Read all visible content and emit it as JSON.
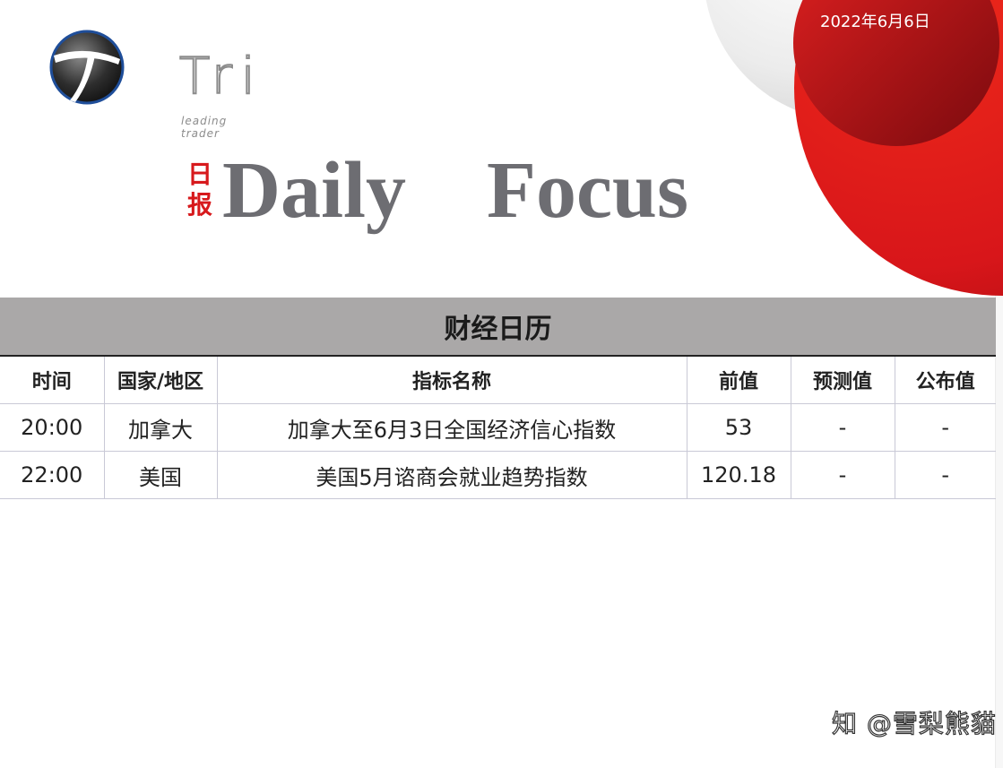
{
  "header": {
    "date": "2022年6月6日",
    "logo_word": "Tri",
    "logo_subtitle": "leading trader",
    "title_cn_top": "日",
    "title_cn_bottom": "报",
    "title": "Daily    Focus"
  },
  "calendar": {
    "title": "财经日历",
    "columns": [
      "时间",
      "国家/地区",
      "指标名称",
      "前值",
      "预测值",
      "公布值"
    ],
    "rows": [
      [
        "20:00",
        "加拿大",
        "加拿大至6月3日全国经济信心指数",
        "53",
        "-",
        "-"
      ],
      [
        "22:00",
        "美国",
        "美国5月谘商会就业趋势指数",
        "120.18",
        "-",
        "-"
      ]
    ]
  },
  "watermark": "知 @雪梨熊貓",
  "colors": {
    "brand_red": "#d7191c",
    "title_grey": "#6d6d72",
    "header_band": "#aaa8a8"
  }
}
